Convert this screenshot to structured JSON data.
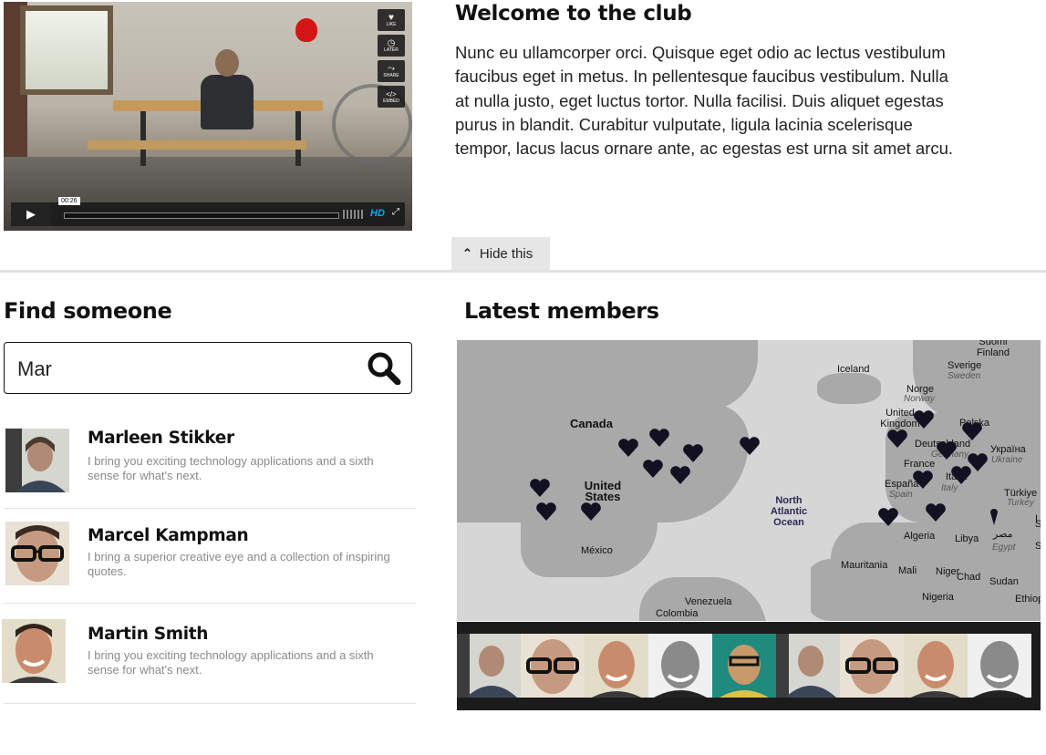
{
  "video": {
    "timestamp": "00:26",
    "hd_label": "HD",
    "buttons": [
      {
        "label": "LIKE",
        "icon": "heart-icon"
      },
      {
        "label": "LATER",
        "icon": "clock-icon"
      },
      {
        "label": "SHARE",
        "icon": "share-icon"
      },
      {
        "label": "EMBED",
        "icon": "embed-icon"
      }
    ]
  },
  "welcome": {
    "title": "Welcome to the club",
    "body": "Nunc eu ullamcorper orci. Quisque eget odio ac lectus vestibulum faucibus eget in metus. In pellentesque faucibus vestibulum. Nulla at nulla justo, eget luctus tortor. Nulla facilisi. Duis aliquet egestas purus in blandit. Curabitur vulputate, ligula lacinia scelerisque tempor, lacus lacus ornare ante, ac egestas est urna sit amet arcu.",
    "hide_label": "Hide this"
  },
  "find": {
    "title": "Find someone",
    "search_value": "Mar",
    "results": [
      {
        "name": "Marleen Stikker",
        "bio": "I bring you exciting technology applications and a sixth sense for what's next."
      },
      {
        "name": "Marcel Kampman",
        "bio": "I bring a superior creative eye and a collection of inspiring quotes."
      },
      {
        "name": "Martin Smith",
        "bio": "I bring you exciting technology applications and a sixth sense for what's next."
      }
    ]
  },
  "members": {
    "title": "Latest members",
    "map_labels": {
      "canada": "Canada",
      "us": "United States",
      "mexico": "México",
      "venezuela": "Venezuela",
      "colombia": "Colombia",
      "atlantic": "North Atlantic Ocean",
      "iceland": "Iceland",
      "finland": "Suomi Finland",
      "sverige": "Sverige",
      "sweden": "Sweden",
      "norge": "Norge",
      "norway": "Norway",
      "uk": "United Kingdom",
      "polska": "Polska",
      "deutschland": "Deutschland",
      "germany": "Germany",
      "france": "France",
      "espana": "España",
      "spain": "Spain",
      "italia": "Italia",
      "italy": "Italy",
      "ukraine_local": "Україна",
      "ukraine": "Ukraine",
      "turkiye": "Türkiye",
      "turkey": "Turkey",
      "algeria": "Algeria",
      "libya": "Libya",
      "egypt_local": "مصر",
      "egypt": "Egypt",
      "mauritania": "Mauritania",
      "mali": "Mali",
      "niger": "Niger",
      "chad": "Chad",
      "sudan": "Sudan",
      "nigeria": "Nigeria",
      "ethiopia": "Ethiop",
      "s1": "S",
      "s2": "S",
      "i1": "I"
    },
    "pin_count": 20,
    "thumbnail_count": 9
  },
  "colors": {
    "pin": "#111122",
    "map_land": "#a9a9a9",
    "map_sea": "#d6d6d6",
    "hd": "#00adef",
    "divider": "#e2e2e2"
  }
}
